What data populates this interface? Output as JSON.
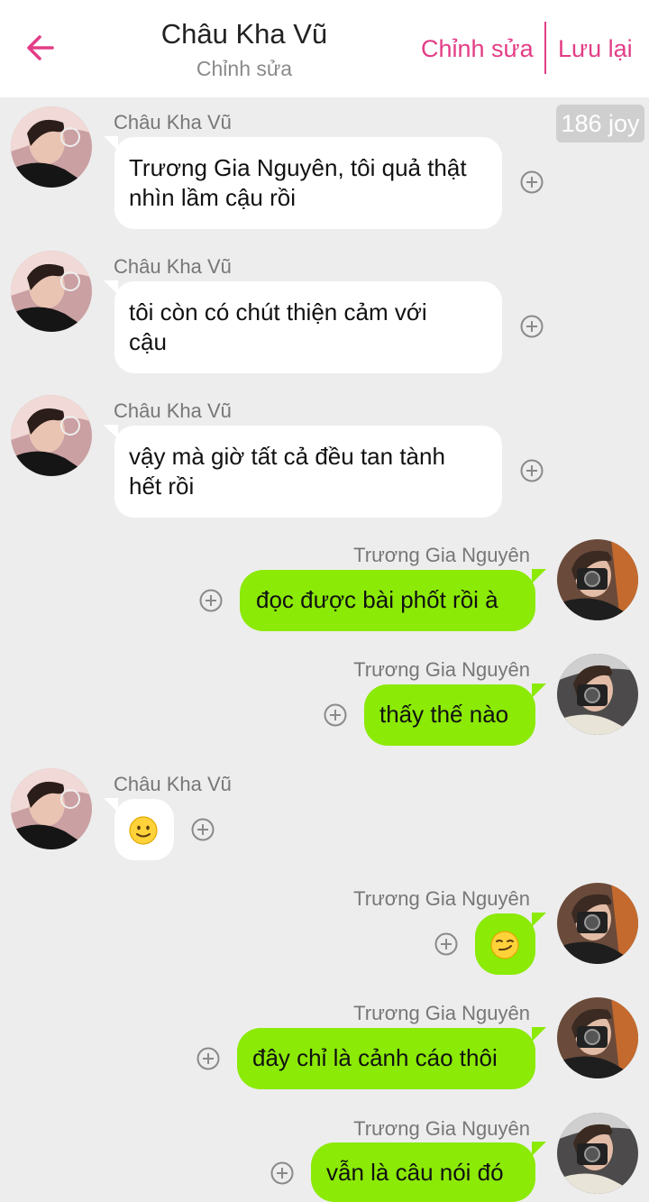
{
  "header": {
    "title": "Châu Kha Vũ",
    "subtitle": "Chỉnh sửa",
    "edit_label": "Chỉnh sửa",
    "save_label": "Lưu lại",
    "accent_color": "#e33d86"
  },
  "badge": {
    "label": "186 joy"
  },
  "icons": {
    "back": "back-arrow-icon",
    "add": "plus-circle-icon",
    "smile": "slight-smile-emoji",
    "smirk": "smirk-emoji"
  },
  "colors": {
    "incoming_bubble": "#ffffff",
    "outgoing_bubble": "#8bea06",
    "background": "#ededed"
  },
  "messages": [
    {
      "sender": "Châu Kha Vũ",
      "side": "left",
      "lines": [
        "Trương Gia Nguyên, tôi quả thật",
        "nhìn lầm cậu rồi"
      ]
    },
    {
      "sender": "Châu Kha Vũ",
      "side": "left",
      "lines": [
        "tôi còn có chút thiện cảm với",
        "cậu"
      ]
    },
    {
      "sender": "Châu Kha Vũ",
      "side": "left",
      "lines": [
        "vậy mà giờ tất cả đều tan tành",
        "hết rồi"
      ]
    },
    {
      "sender": "Trương Gia Nguyên",
      "side": "right",
      "lines": [
        "đọc được bài phốt rồi à"
      ]
    },
    {
      "sender": "Trương Gia Nguyên",
      "side": "right",
      "lines": [
        "thấy thế nào"
      ]
    },
    {
      "sender": "Châu Kha Vũ",
      "side": "left",
      "emoji": "slight-smile"
    },
    {
      "sender": "Trương Gia Nguyên",
      "side": "right",
      "emoji": "smirk"
    },
    {
      "sender": "Trương Gia Nguyên",
      "side": "right",
      "lines": [
        "đây chỉ là cảnh cáo thôi"
      ]
    },
    {
      "sender": "Trương Gia Nguyên",
      "side": "right",
      "lines": [
        "vẫn là câu nói đó"
      ]
    }
  ]
}
